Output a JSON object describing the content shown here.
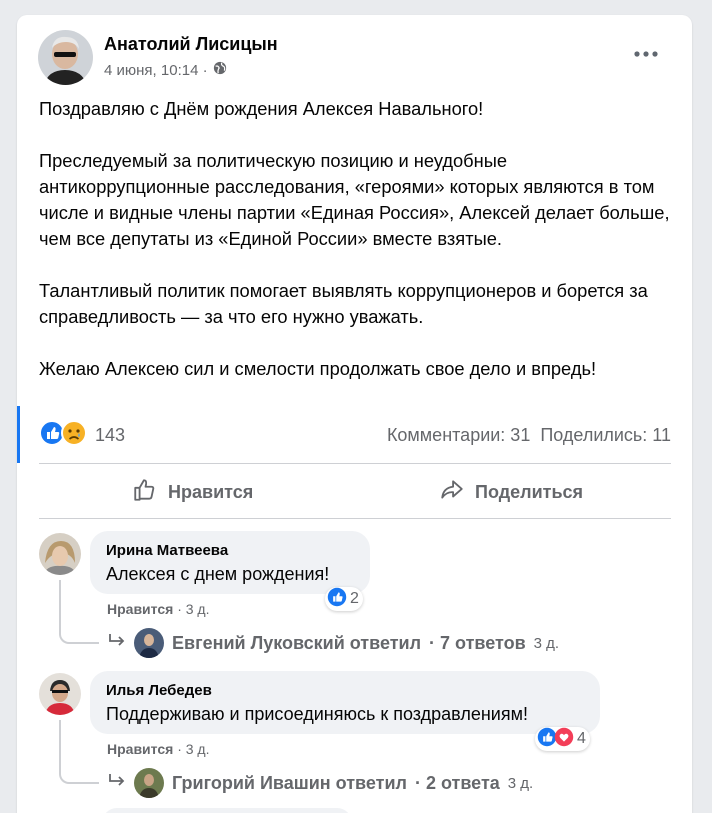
{
  "post": {
    "author": "Анатолий Лисицын",
    "date": "4 июня, 10:14 ·",
    "privacy_icon": "globe-icon",
    "paragraphs": [
      "Поздравляю с Днём рождения Алексея Навального!",
      "Преследуемый за политическую позицию и неудобные антикоррупционные расследования, «героями» которых являются в том числе и видные члены партии «Единая Россия», Алексей делает больше, чем все депутаты из «Единой России» вместе взятые.",
      "Талантливый политик помогает выявлять коррупционеров и борется за справедливость — за что его нужно уважать.",
      "Желаю Алексею сил и смелости продолжать свое дело и впредь!"
    ],
    "reaction_count": "143",
    "comments_label": "Комментарии: 31",
    "shares_label": "Поделились: 11"
  },
  "actions": {
    "like": "Нравится",
    "share": "Поделиться"
  },
  "comments": [
    {
      "name": "Ирина Матвеева",
      "text": "Алексея с днем рождения!",
      "like_label": "Нравится",
      "time": "· 3 д.",
      "reactions": "2",
      "reply_author": "Евгений Луковский ответил",
      "reply_count": "· 7 ответов",
      "reply_time": "3 д."
    },
    {
      "name": "Илья Лебедев",
      "text": "Поддерживаю и присоединяюсь к поздравлениям!",
      "like_label": "Нравится",
      "time": "· 3 д.",
      "reactions": "4",
      "reply_author": "Григорий Ивашин ответил",
      "reply_count": "· 2 ответа",
      "reply_time": "3 д."
    }
  ],
  "colors": {
    "accent": "#1877f2",
    "secondary_text": "#65676b",
    "bubble": "#f0f2f5",
    "love": "#f33e58",
    "sad": "#f7b125"
  }
}
